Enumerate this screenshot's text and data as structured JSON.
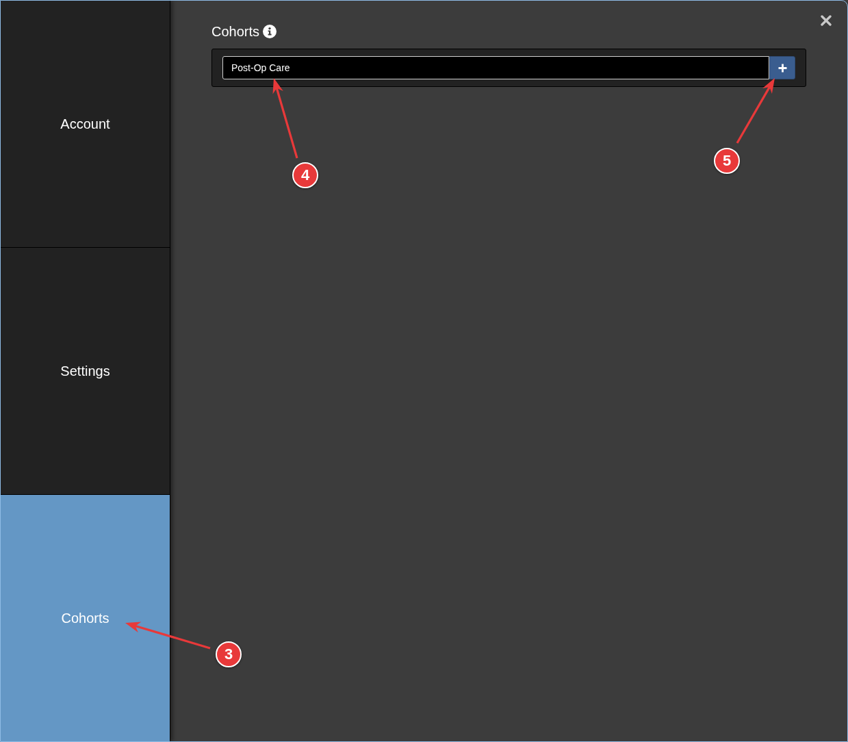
{
  "sidebar": {
    "tabs": [
      {
        "label": "Account",
        "selected": false
      },
      {
        "label": "Settings",
        "selected": false
      },
      {
        "label": "Cohorts",
        "selected": true
      }
    ]
  },
  "main": {
    "title": "Cohorts",
    "cohort_field": {
      "value": "Post-Op Care"
    }
  },
  "callouts": [
    {
      "label": "4"
    },
    {
      "label": "5"
    },
    {
      "label": "3"
    }
  ]
}
